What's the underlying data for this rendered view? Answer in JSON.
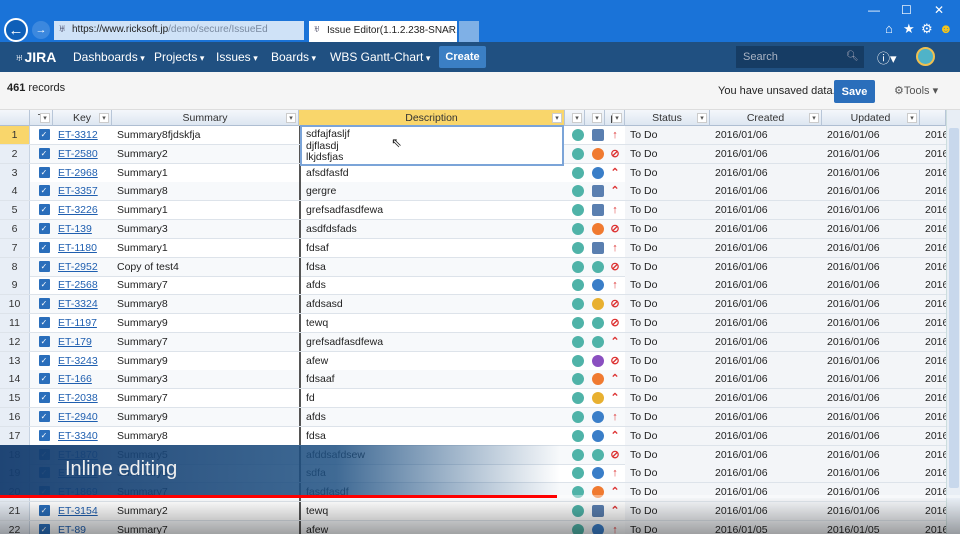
{
  "browser": {
    "url_host": "https://www.ricksoft.jp",
    "url_path": "/demo/secure/IssueEd",
    "tab_title": "Issue Editor(1.1.2.238-SNAR..."
  },
  "nav": {
    "logo": "JIRA",
    "menus": [
      "Dashboards",
      "Projects",
      "Issues",
      "Boards",
      "WBS Gantt-Chart"
    ],
    "create": "Create",
    "search_placeholder": "Search"
  },
  "toolbar": {
    "count": "461",
    "records_label": "records",
    "unsaved": "You have unsaved data.",
    "save": "Save",
    "tools": "Tools"
  },
  "grid": {
    "columns": [
      "T",
      "Key",
      "Summary",
      "Description",
      "g",
      "o",
      "pi",
      "Status",
      "Created",
      "Updated"
    ],
    "editor_value": "sdfajfasljf\ndjflasdj\nlkjdsfjas",
    "rows": [
      {
        "n": "1",
        "key": "ET-3312",
        "summary": "Summary8fjdskfja",
        "desc": "",
        "o": "square",
        "p": "up",
        "status": "To Do",
        "created": "2016/01/06",
        "updated": "2016/01/06"
      },
      {
        "n": "2",
        "key": "ET-2580",
        "summary": "Summary2",
        "desc": "",
        "o": "orange",
        "p": "block",
        "status": "To Do",
        "created": "2016/01/06",
        "updated": "2016/01/06"
      },
      {
        "n": "3",
        "key": "ET-2968",
        "summary": "Summary1",
        "desc": "afsdfasfd",
        "o": "blue",
        "p": "dbl",
        "status": "To Do",
        "created": "2016/01/06",
        "updated": "2016/01/06"
      },
      {
        "n": "4",
        "key": "ET-3357",
        "summary": "Summary8",
        "desc": "gergre",
        "o": "square",
        "p": "dbl",
        "status": "To Do",
        "created": "2016/01/06",
        "updated": "2016/01/06"
      },
      {
        "n": "5",
        "key": "ET-3226",
        "summary": "Summary1",
        "desc": "grefsadfasdfewa",
        "o": "square",
        "p": "up",
        "status": "To Do",
        "created": "2016/01/06",
        "updated": "2016/01/06"
      },
      {
        "n": "6",
        "key": "ET-139",
        "summary": "Summary3",
        "desc": "asdfdsfads",
        "o": "orange",
        "p": "block",
        "status": "To Do",
        "created": "2016/01/06",
        "updated": "2016/01/06"
      },
      {
        "n": "7",
        "key": "ET-1180",
        "summary": "Summary1",
        "desc": "fdsaf",
        "o": "square",
        "p": "up",
        "status": "To Do",
        "created": "2016/01/06",
        "updated": "2016/01/06"
      },
      {
        "n": "8",
        "key": "ET-2952",
        "summary": "Copy of test4",
        "desc": "fdsa",
        "o": "teal",
        "p": "block",
        "status": "To Do",
        "created": "2016/01/06",
        "updated": "2016/01/06"
      },
      {
        "n": "9",
        "key": "ET-2568",
        "summary": "Summary7",
        "desc": "afds",
        "o": "blue",
        "p": "up",
        "status": "To Do",
        "created": "2016/01/06",
        "updated": "2016/01/06"
      },
      {
        "n": "10",
        "key": "ET-3324",
        "summary": "Summary8",
        "desc": "afdsasd",
        "o": "yellow",
        "p": "block",
        "status": "To Do",
        "created": "2016/01/06",
        "updated": "2016/01/06"
      },
      {
        "n": "11",
        "key": "ET-1197",
        "summary": "Summary9",
        "desc": "tewq",
        "o": "teal",
        "p": "block",
        "status": "To Do",
        "created": "2016/01/06",
        "updated": "2016/01/06"
      },
      {
        "n": "12",
        "key": "ET-179",
        "summary": "Summary7",
        "desc": "grefsadfasdfewa",
        "o": "teal",
        "p": "dbl",
        "status": "To Do",
        "created": "2016/01/06",
        "updated": "2016/01/06"
      },
      {
        "n": "13",
        "key": "ET-3243",
        "summary": "Summary9",
        "desc": "afew",
        "o": "purple",
        "p": "block",
        "status": "To Do",
        "created": "2016/01/06",
        "updated": "2016/01/06"
      },
      {
        "n": "14",
        "key": "ET-166",
        "summary": "Summary3",
        "desc": "fdsaaf",
        "o": "orange",
        "p": "dbl",
        "status": "To Do",
        "created": "2016/01/06",
        "updated": "2016/01/06"
      },
      {
        "n": "15",
        "key": "ET-2038",
        "summary": "Summary7",
        "desc": "fd",
        "o": "yellow",
        "p": "dbl",
        "status": "To Do",
        "created": "2016/01/06",
        "updated": "2016/01/06"
      },
      {
        "n": "16",
        "key": "ET-2940",
        "summary": "Summary9",
        "desc": "afds",
        "o": "blue",
        "p": "up",
        "status": "To Do",
        "created": "2016/01/06",
        "updated": "2016/01/06"
      },
      {
        "n": "17",
        "key": "ET-3340",
        "summary": "Summary8",
        "desc": "fdsa",
        "o": "blue",
        "p": "dbl",
        "status": "To Do",
        "created": "2016/01/06",
        "updated": "2016/01/06"
      },
      {
        "n": "18",
        "key": "ET-1870",
        "summary": "Summary5",
        "desc": "afddsafdsew",
        "o": "teal",
        "p": "block",
        "status": "To Do",
        "created": "2016/01/06",
        "updated": "2016/01/06"
      },
      {
        "n": "19",
        "key": "ET-1521",
        "summary": "Summary6",
        "desc": "sdfa",
        "o": "blue",
        "p": "up",
        "status": "To Do",
        "created": "2016/01/06",
        "updated": "2016/01/06"
      },
      {
        "n": "20",
        "key": "ET-1869",
        "summary": "Summary7",
        "desc": "fasdfasdf",
        "o": "orange",
        "p": "dbl",
        "status": "To Do",
        "created": "2016/01/06",
        "updated": "2016/01/06"
      },
      {
        "n": "21",
        "key": "ET-3154",
        "summary": "Summary2",
        "desc": "tewq",
        "o": "square",
        "p": "dbl",
        "status": "To Do",
        "created": "2016/01/06",
        "updated": "2016/01/06"
      },
      {
        "n": "22",
        "key": "ET-89",
        "summary": "Summary7",
        "desc": "afew",
        "o": "blue",
        "p": "up",
        "status": "To Do",
        "created": "2016/01/05",
        "updated": "2016/01/05"
      }
    ],
    "extra_col_prefix": "2016"
  },
  "overlay": {
    "caption": "Inline editing",
    "progress": 0.58
  },
  "colors": {
    "chrome": "#1a73d8",
    "nav": "#205081",
    "accent": "#2a6ebb",
    "selected_header": "#f9d66b",
    "priority": "#d33333"
  },
  "avatar_colors": {
    "teal": "#4fb3a8",
    "orange": "#f07a30",
    "blue": "#3a7ec8",
    "square": "#5a7fb0",
    "yellow": "#e8b030",
    "purple": "#8a4fc0"
  },
  "icons": {
    "up": "priority-major-icon",
    "dbl": "priority-critical-icon",
    "block": "priority-blocker-icon"
  }
}
